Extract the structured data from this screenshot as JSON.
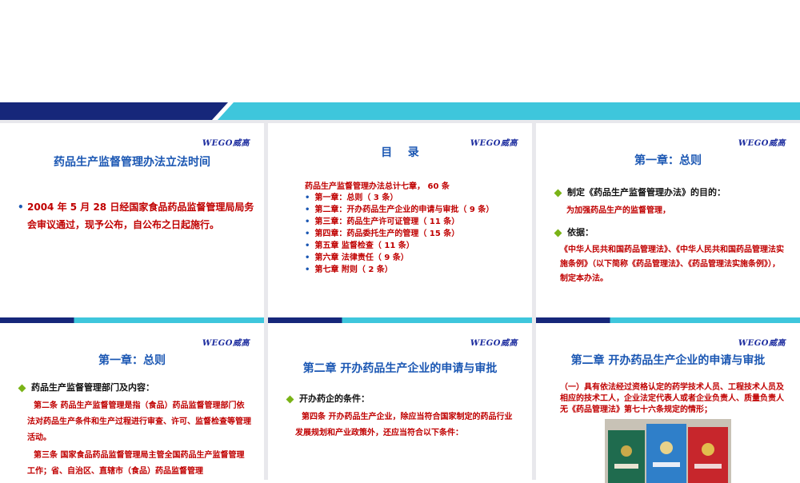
{
  "logo": "WEGO威高",
  "colors": {
    "title_blue": "#1b57b3",
    "text_red": "#c00000",
    "banner_dark": "#16277a",
    "banner_light": "#3ec6dc",
    "diamond_green": "#7ab317"
  },
  "slide1": {
    "title": "药品生产监督管理办法立法时间",
    "bullet": "2004 年 5 月 28 日经国家食品药品监督管理局局务会审议通过，现予公布，自公布之日起施行。"
  },
  "slide2": {
    "title": "目    录",
    "intro": "药品生产监督管理办法总计七章， 60 条",
    "items": [
      "第一章：总则（ 3 条）",
      "第二章：开办药品生产企业的申请与审批（ 9 条）",
      "第三章：药品生产许可证管理（ 11 条）",
      "第四章：药品委托生产的管理（ 15 条）",
      "第五章   监督检查（ 11 条）",
      "第六章   法律责任（ 9 条）",
      "第七章   附则（ 2 条）"
    ]
  },
  "slide3": {
    "title": "第一章：总则",
    "point1": "制定《药品生产监督管理办法》的目的：",
    "point1_text": "为加强药品生产的监督管理，",
    "point2": "依据：",
    "point2_text": "《中华人民共和国药品管理法》、《中华人民共和国药品管理法实施条例》（以下简称《药品管理法》、《药品管理法实施条例》），制定本办法。"
  },
  "slide4": {
    "title": "第一章：总则",
    "point1": "药品生产监督管理部门及内容：",
    "para1": "第二条   药品生产监督管理是指（食品）药品监督管理部门依法对药品生产条件和生产过程进行审查、许可、监督检查等管理活动。",
    "para2": "第三条   国家食品药品监督管理局主管全国药品生产监督管理工作；省、自治区、直辖市（食品）药品监督管理"
  },
  "slide5": {
    "title": "第二章   开办药品生产企业的申请与审批",
    "point1": "开办药企的条件：",
    "para1": "第四条   开办药品生产企业，除应当符合国家制定的药品行业发展规划和产业政策外，还应当符合以下条件："
  },
  "slide6": {
    "title": "第二章   开办药品生产企业的申请与审批",
    "para1": "（一）具有依法经过资格认定的药学技术人员、工程技术人员及相应的技术工人，企业法定代表人或者企业负责人、质量负责人无《药品管理法》第七十六条规定的情形；"
  }
}
